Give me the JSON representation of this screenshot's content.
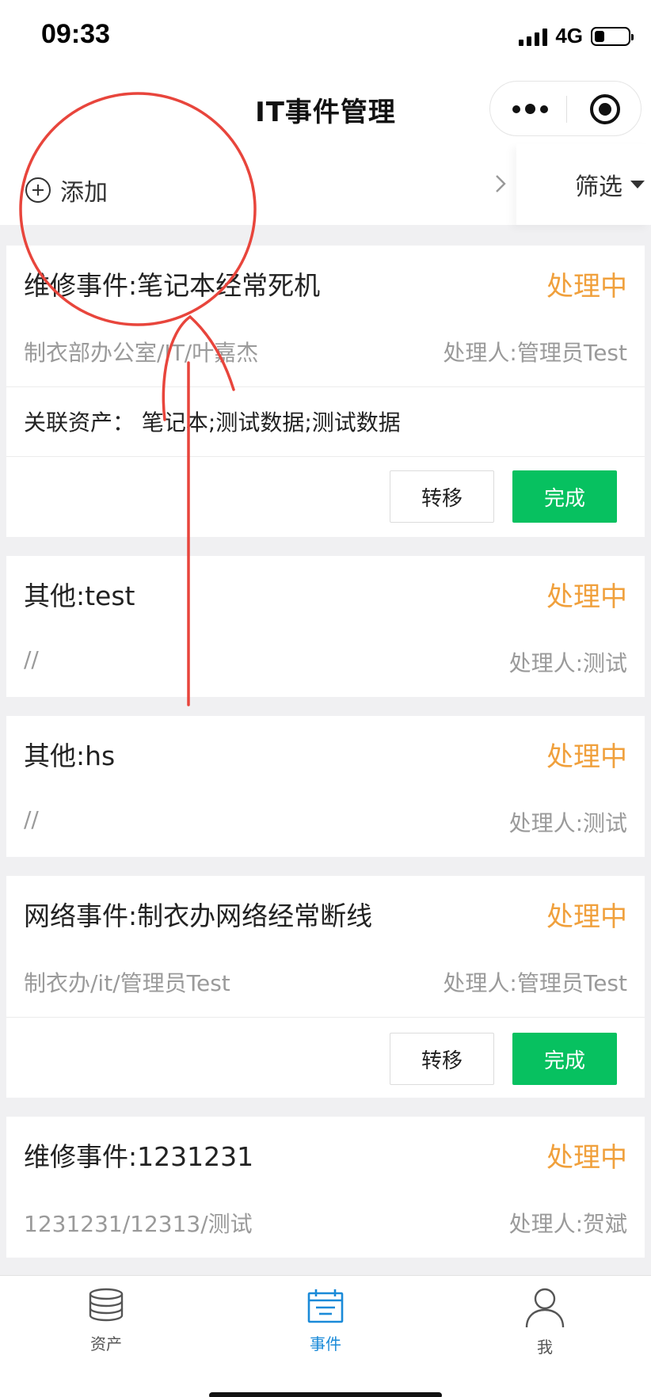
{
  "status_bar": {
    "time": "09:33",
    "network": "4G"
  },
  "nav": {
    "title": "IT事件管理"
  },
  "toolbar": {
    "add_label": "添加",
    "filter_label": "筛选"
  },
  "events": [
    {
      "title": "维修事件:笔记本经常死机",
      "status": "处理中",
      "location": "制衣部办公室/IT/叶嘉杰",
      "handler": "处理人:管理员Test",
      "assets": "关联资产：  笔记本;测试数据;测试数据",
      "transfer_label": "转移",
      "done_label": "完成"
    },
    {
      "title": "其他:test",
      "status": "处理中",
      "location": "//",
      "handler": "处理人:测试"
    },
    {
      "title": "其他:hs",
      "status": "处理中",
      "location": "//",
      "handler": "处理人:测试"
    },
    {
      "title": "网络事件:制衣办网络经常断线",
      "status": "处理中",
      "location": "制衣办/it/管理员Test",
      "handler": "处理人:管理员Test",
      "transfer_label": "转移",
      "done_label": "完成"
    },
    {
      "title": "维修事件:1231231",
      "status": "处理中",
      "location": "1231231/12313/测试",
      "handler": "处理人:贺斌"
    }
  ],
  "tabs": [
    {
      "label": "资产",
      "icon": "database-icon"
    },
    {
      "label": "事件",
      "icon": "calendar-icon",
      "active": true
    },
    {
      "label": "我",
      "icon": "user-icon"
    }
  ],
  "colors": {
    "status": "#f0a03c",
    "primary": "#07c160",
    "tab_active": "#1a8ad8",
    "annotation": "#e8453c"
  }
}
